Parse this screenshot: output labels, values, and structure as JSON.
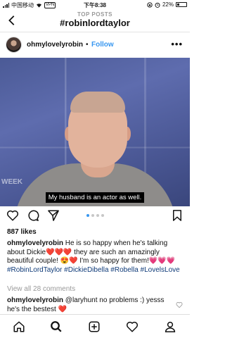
{
  "status": {
    "carrier": "中国移动",
    "vpn": "VPN",
    "time": "下午8:38",
    "battery": "22%",
    "battery_level": 0.22
  },
  "header": {
    "subtitle": "TOP POSTS",
    "title": "#robinlordtaylor"
  },
  "post": {
    "username": "ohmylovelyrobin",
    "separator": "•",
    "follow_label": "Follow",
    "photo_caption": "My husband is an actor as well.",
    "photo_logo": "WEEK",
    "likes": "887 likes",
    "caption_user": "ohmylovelyrobin",
    "caption_text": "He is so happy when he's talking about Dickie❤️❤️❤️ they are such an amazingly beautiful couple! 😍❤️ I'm so happy for them!💗💗💗",
    "hashtags": "#RobinLordTaylor #DickieDibella #Robella #LovelsLove",
    "view_all": "View all 28 comments",
    "comment_user": "ohmylovelyrobin",
    "comment_text": "@laryhunt no problems :) yesss he's the bestest ❤️",
    "carousel": {
      "count": 4,
      "active": 1
    }
  },
  "colors": {
    "accent": "#3897f0",
    "hashtag": "#0e3a78",
    "muted": "#999999"
  },
  "icons": [
    "back-arrow-icon",
    "more-icon",
    "heart-icon",
    "comment-icon",
    "share-icon",
    "bookmark-icon",
    "home-icon",
    "search-icon",
    "add-icon",
    "activity-heart-icon",
    "profile-icon"
  ]
}
